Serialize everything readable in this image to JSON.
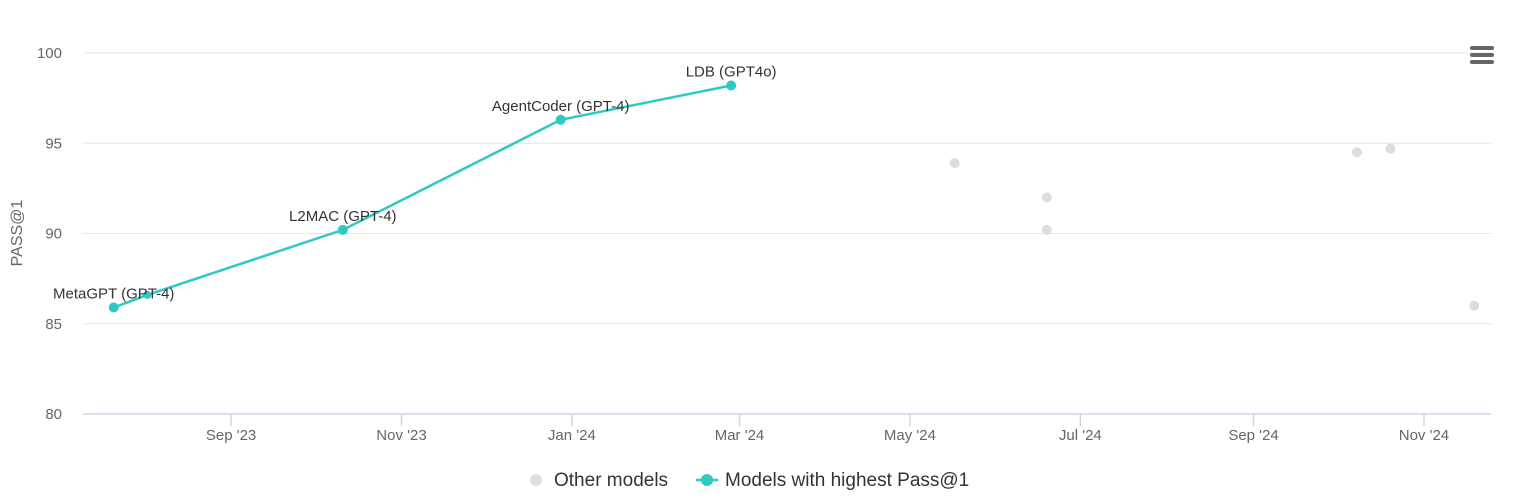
{
  "chart_data": {
    "type": "line",
    "title": "",
    "xlabel": "",
    "ylabel": "PASS@1",
    "ylim": [
      80,
      100
    ],
    "yticks": [
      "80",
      "85",
      "90",
      "95",
      "100"
    ],
    "xlim": [
      "2023-07-10",
      "2024-11-25"
    ],
    "xticks": [
      {
        "date": "2023-09-01",
        "label": "Sep '23"
      },
      {
        "date": "2023-11-01",
        "label": "Nov '23"
      },
      {
        "date": "2024-01-01",
        "label": "Jan '24"
      },
      {
        "date": "2024-03-01",
        "label": "Mar '24"
      },
      {
        "date": "2024-05-01",
        "label": "May '24"
      },
      {
        "date": "2024-07-01",
        "label": "Jul '24"
      },
      {
        "date": "2024-09-01",
        "label": "Sep '24"
      },
      {
        "date": "2024-11-01",
        "label": "Nov '24"
      }
    ],
    "grid": true,
    "legend_position": "bottom-center",
    "series": [
      {
        "name": "Other models",
        "kind": "scatter",
        "color": "#dddddd",
        "points": [
          {
            "x": "2024-05-17",
            "y": 93.9
          },
          {
            "x": "2024-06-19",
            "y": 92.0
          },
          {
            "x": "2024-06-19",
            "y": 90.2
          },
          {
            "x": "2024-10-08",
            "y": 94.5
          },
          {
            "x": "2024-10-20",
            "y": 94.7
          },
          {
            "x": "2024-11-19",
            "y": 86.0
          }
        ]
      },
      {
        "name": "Models with highest Pass@1",
        "kind": "line",
        "color": "#2ec9c2",
        "points": [
          {
            "x": "2023-07-21",
            "y": 85.9,
            "label": "MetaGPT (GPT-4)"
          },
          {
            "x": "2023-08-02",
            "y": 86.6,
            "label": ""
          },
          {
            "x": "2023-10-11",
            "y": 90.2,
            "label": "L2MAC (GPT-4)"
          },
          {
            "x": "2023-12-28",
            "y": 96.3,
            "label": "AgentCoder (GPT-4)"
          },
          {
            "x": "2024-02-27",
            "y": 98.2,
            "label": "LDB (GPT4o)"
          }
        ]
      }
    ]
  },
  "icons": {
    "menu": "hamburger-menu-icon"
  }
}
